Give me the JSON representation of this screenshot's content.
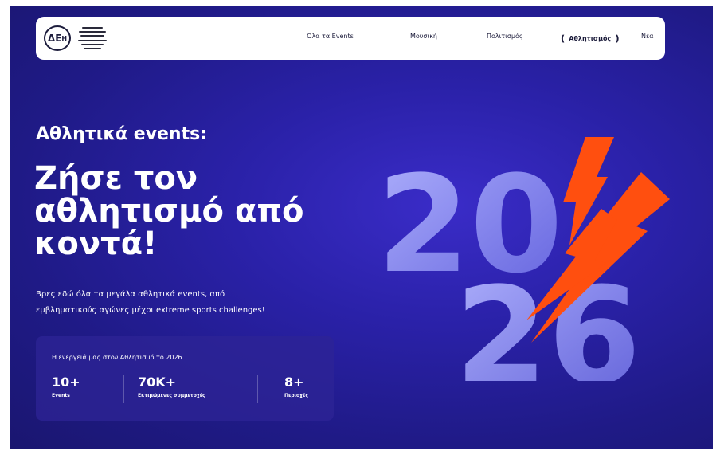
{
  "navbar": {
    "logo_text": "ΔΕ",
    "logo_sub": "Η",
    "items": [
      {
        "label": "Όλα τα Events"
      },
      {
        "label": "Μουσική"
      },
      {
        "label": "Πολιτισμός"
      },
      {
        "label": "Αθλητισμός"
      },
      {
        "label": "Νέα"
      }
    ]
  },
  "hero": {
    "eyebrow": "Αθλητικά events:",
    "headline": [
      "Ζήσε τον",
      "αθλητισμό από",
      "κοντά!"
    ],
    "description": [
      "Βρες εδώ όλα τα μεγάλα αθλητικά events, από",
      "εμβληματικούς αγώνες μέχρι extreme sports challenges!"
    ]
  },
  "stats": {
    "title": "Η ενέργειά μας στον Αθλητισμό το 2026",
    "items": [
      {
        "value": "10+",
        "label": "Events"
      },
      {
        "value": "70K+",
        "label": "Εκτιμώμενες συμμετοχές"
      },
      {
        "value": "8+",
        "label": "Περιοχές"
      }
    ]
  },
  "graphic": {
    "top_digits": "20",
    "bottom_digits": "26",
    "accent_color": "#ff4f0f",
    "digit_color": "#8f8ff0"
  },
  "colors": {
    "background": "#2a21a8",
    "navbar": "#ffffff",
    "text": "#ffffff"
  }
}
